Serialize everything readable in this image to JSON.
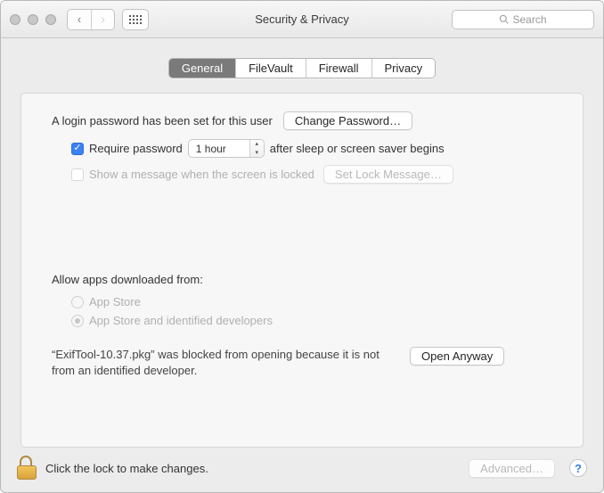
{
  "window": {
    "title": "Security & Privacy",
    "search_placeholder": "Search"
  },
  "tabs": {
    "general": "General",
    "filevault": "FileVault",
    "firewall": "Firewall",
    "privacy": "Privacy"
  },
  "login": {
    "password_set_text": "A login password has been set for this user",
    "change_password_btn": "Change Password…",
    "require_password_label": "Require password",
    "require_password_delay": "1 hour",
    "require_password_suffix": "after sleep or screen saver begins",
    "show_message_label": "Show a message when the screen is locked",
    "set_lock_message_btn": "Set Lock Message…"
  },
  "gatekeeper": {
    "allow_label": "Allow apps downloaded from:",
    "option_appstore": "App Store",
    "option_identified": "App Store and identified developers",
    "blocked_text": "“ExifTool-10.37.pkg” was blocked from opening because it is not from an identified developer.",
    "open_anyway_btn": "Open Anyway"
  },
  "footer": {
    "lock_text": "Click the lock to make changes.",
    "advanced_btn": "Advanced…",
    "help": "?"
  }
}
